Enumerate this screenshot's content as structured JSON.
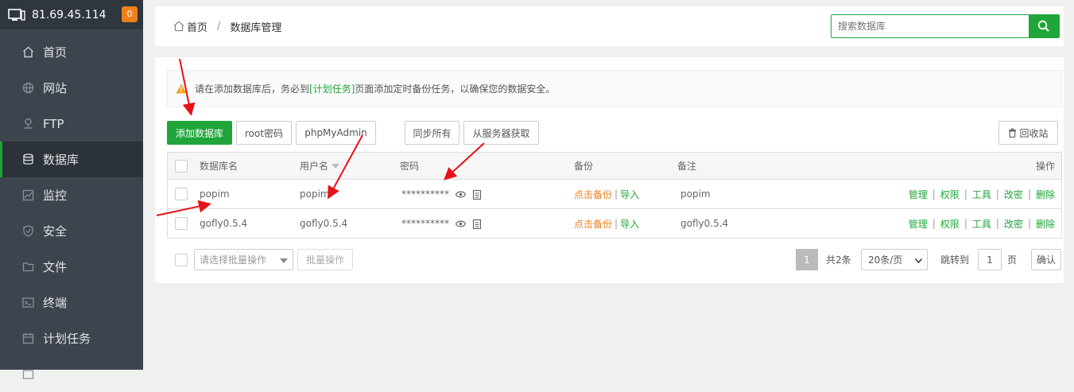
{
  "sidebar": {
    "server_ip": "81.69.45.114",
    "badge_count": "0",
    "items": [
      {
        "label": "首页",
        "icon": "home-icon"
      },
      {
        "label": "网站",
        "icon": "globe-icon"
      },
      {
        "label": "FTP",
        "icon": "ftp-icon"
      },
      {
        "label": "数据库",
        "icon": "database-icon",
        "active": true
      },
      {
        "label": "监控",
        "icon": "monitor-icon"
      },
      {
        "label": "安全",
        "icon": "shield-icon"
      },
      {
        "label": "文件",
        "icon": "folder-icon"
      },
      {
        "label": "终端",
        "icon": "terminal-icon"
      },
      {
        "label": "计划任务",
        "icon": "calendar-icon"
      }
    ]
  },
  "breadcrumb": {
    "home": "首页",
    "separator": "/",
    "current": "数据库管理"
  },
  "search": {
    "placeholder": "搜索数据库"
  },
  "tip": {
    "prefix": "请在添加数据库后，务必到",
    "link": "[计划任务]",
    "suffix": "页面添加定时备份任务，以确保您的数据安全。"
  },
  "toolbar": {
    "add_db": "添加数据库",
    "root_pw": "root密码",
    "phpmyadmin": "phpMyAdmin",
    "sync_all": "同步所有",
    "fetch_server": "从服务器获取",
    "recycle": "回收站"
  },
  "table": {
    "headers": {
      "name": "数据库名",
      "user": "用户名",
      "password": "密码",
      "backup": "备份",
      "note": "备注",
      "ops": "操作"
    },
    "rows": [
      {
        "name": "popim",
        "user": "popim",
        "password": "**********",
        "backup": "点击备份",
        "import": "导入",
        "note": "popim"
      },
      {
        "name": "gofly0.5.4",
        "user": "gofly0.5.4",
        "password": "**********",
        "backup": "点击备份",
        "import": "导入",
        "note": "gofly0.5.4"
      }
    ],
    "ops": [
      "管理",
      "权限",
      "工具",
      "改密",
      "删除"
    ]
  },
  "footer": {
    "bulk_placeholder": "请选择批量操作",
    "bulk_button": "批量操作",
    "current_page": "1",
    "total": "共2条",
    "per_page": "20条/页",
    "jump_label": "跳转到",
    "jump_value": "1",
    "page_unit": "页",
    "confirm": "确认"
  },
  "colors": {
    "accent": "#20a53a",
    "warning": "#f0801a",
    "sidebar_bg": "#3c444d",
    "annotation": "#e8121a"
  }
}
